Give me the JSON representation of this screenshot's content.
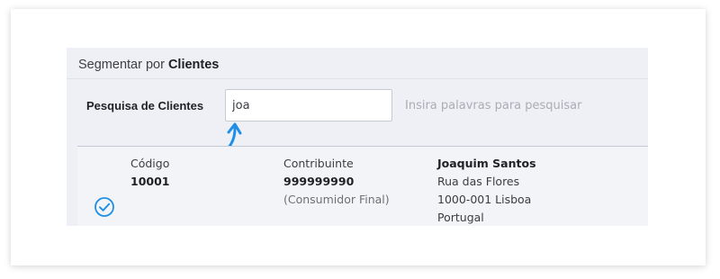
{
  "panel": {
    "title_prefix": "Segmentar por",
    "title_bold": "Clientes"
  },
  "search": {
    "label": "Pesquisa de Clientes",
    "value": "joa",
    "hint": "Insira palavras para pesquisar"
  },
  "result": {
    "selected": true,
    "code_label": "Código",
    "code_value": "10001",
    "tax_label": "Contribuinte",
    "tax_value": "999999990",
    "tax_note": "(Consumidor Final)",
    "name": "Joaquim Santos",
    "address_line1": "Rua das Flores",
    "address_line2": "1000-001 Lisboa",
    "country": "Portugal"
  },
  "colors": {
    "accent": "#1f8fe6",
    "panel_bg": "#eef0f5"
  },
  "icons": {
    "selected": "check-circle-icon",
    "annotation": "curved-arrow-icon"
  }
}
